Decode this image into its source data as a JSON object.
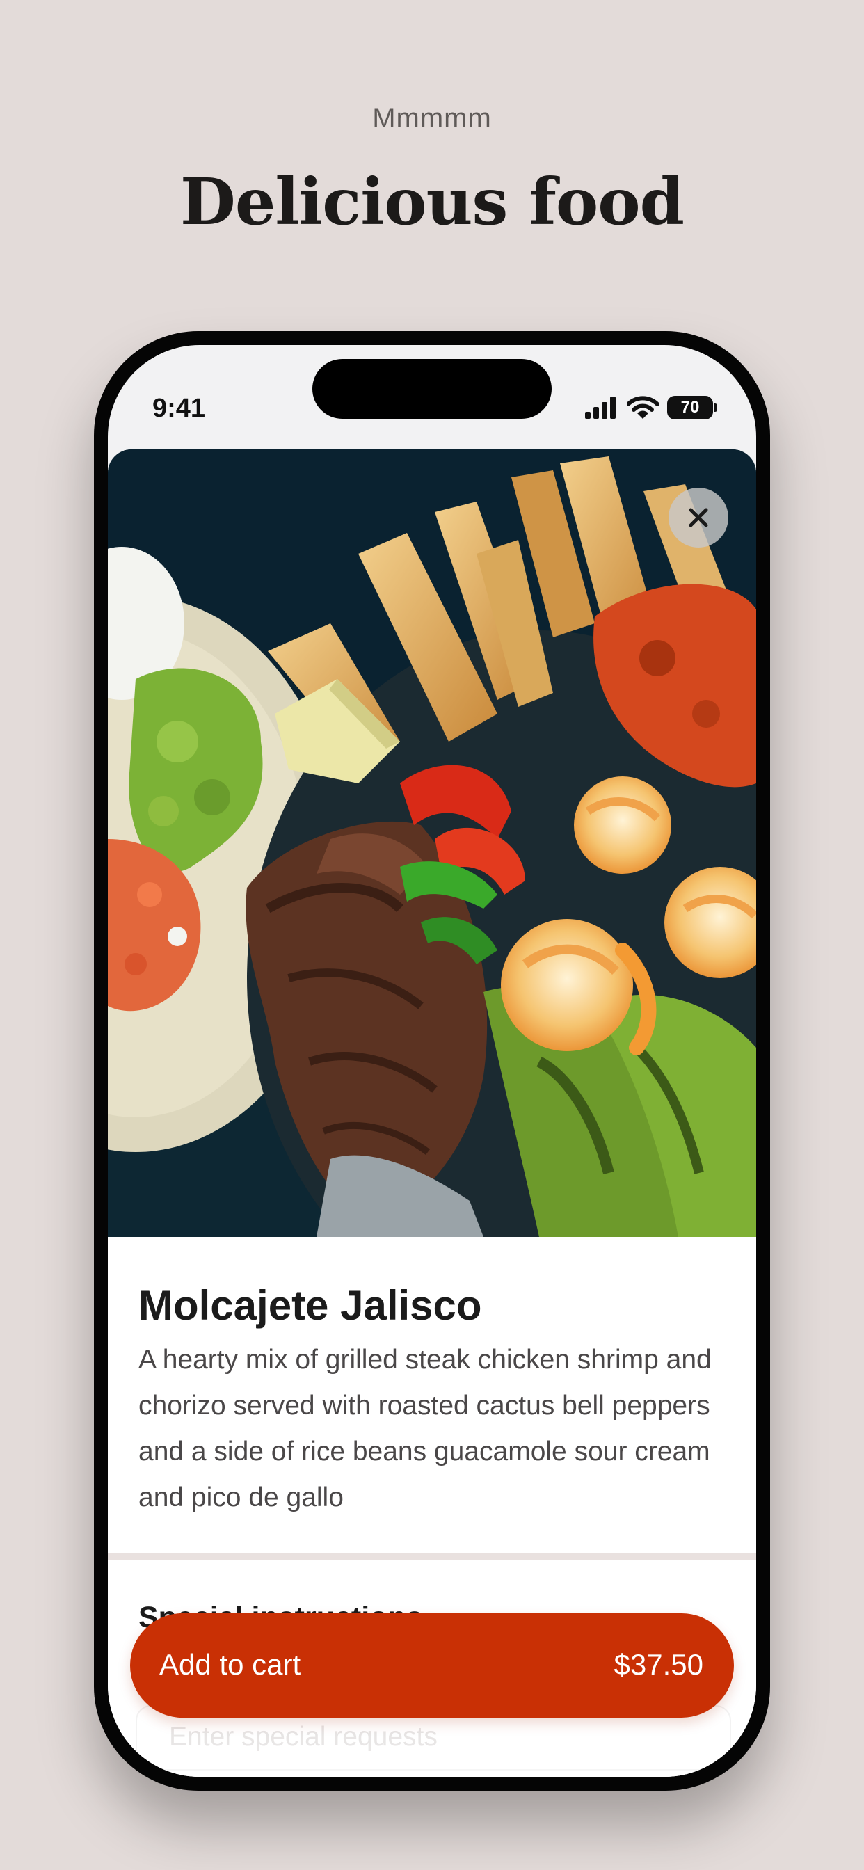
{
  "header": {
    "eyebrow": "Mmmmm",
    "title": "Delicious food"
  },
  "status_bar": {
    "time": "9:41",
    "battery": "70",
    "icons": [
      "cellular-signal-icon",
      "wifi-icon",
      "battery-icon"
    ]
  },
  "item": {
    "image_alt": "Molcajete Jalisco platter",
    "title": "Molcajete Jalisco",
    "description": "A hearty mix of grilled steak chicken shrimp and chorizo served with roasted cactus bell peppers and a side of rice beans guacamole sour cream and pico de gallo"
  },
  "special_instructions": {
    "label": "Special instructions",
    "placeholder": "Enter special requests"
  },
  "cart": {
    "label": "Add to cart",
    "price": "$37.50"
  },
  "colors": {
    "background": "#e3dbd9",
    "accent": "#c93005",
    "text": "#1b1b1b"
  }
}
